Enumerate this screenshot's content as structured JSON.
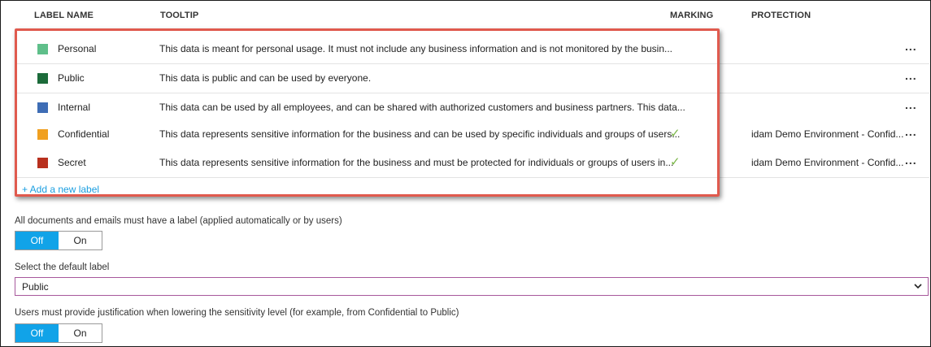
{
  "columns": {
    "label_name": "LABEL NAME",
    "tooltip": "TOOLTIP",
    "marking": "MARKING",
    "protection": "PROTECTION"
  },
  "labels": [
    {
      "name": "Personal",
      "color": "#5fbf8a",
      "tooltip": "This data is meant for personal usage. It must not include any business information and is not monitored by the busin...",
      "marking": "",
      "protection": "",
      "more": "..."
    },
    {
      "name": "Public",
      "color": "#1c6b3a",
      "tooltip": "This data is public and can be used by everyone.",
      "marking": "",
      "protection": "",
      "more": "..."
    },
    {
      "name": "Internal",
      "color": "#3e6db5",
      "tooltip": "This data can be used by all employees, and can be shared with authorized customers and business partners. This data...",
      "marking": "",
      "protection": "",
      "more": "..."
    },
    {
      "name": "Confidential",
      "color": "#f0a020",
      "tooltip": "This data represents sensitive information for the business and can be used by specific individuals and groups of users...",
      "marking": "✓",
      "protection": "idam Demo Environment - Confid...",
      "more": "..."
    },
    {
      "name": "Secret",
      "color": "#b8301e",
      "tooltip": "This data represents sensitive information for the business and must be protected for individuals or groups of users in...",
      "marking": "✓",
      "protection": "idam Demo Environment - Confid...",
      "more": "..."
    }
  ],
  "add_label_link": "+ Add a new label",
  "require_label": {
    "text": "All documents and emails must have a label (applied automatically or by users)",
    "off": "Off",
    "on": "On",
    "selected": "Off"
  },
  "default_label": {
    "text": "Select the default label",
    "value": "Public"
  },
  "justification": {
    "text": "Users must provide justification when lowering the sensitivity level (for example, from Confidential to Public)",
    "off": "Off",
    "on": "On",
    "selected": "Off"
  },
  "colors": {
    "accent": "#11a3e8",
    "highlight_box": "#e05a4e",
    "checkmark": "#7ab648",
    "select_border": "#a7589c"
  }
}
